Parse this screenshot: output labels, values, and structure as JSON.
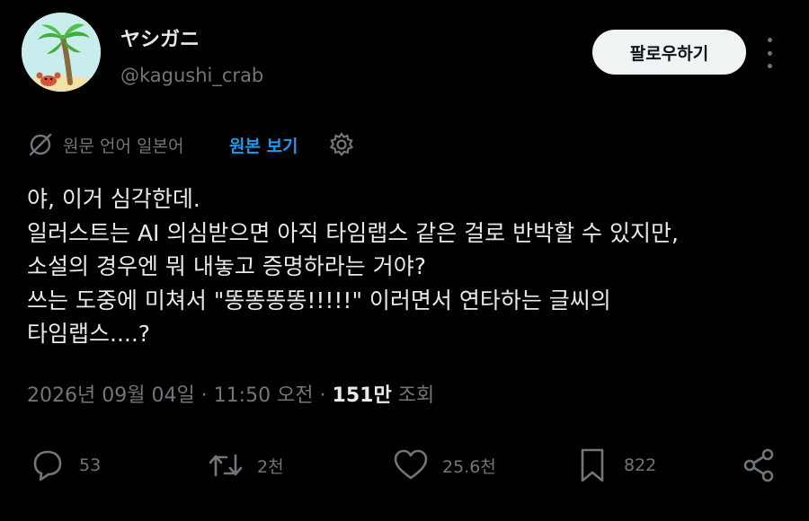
{
  "header": {
    "display_name": "ヤシガニ",
    "handle": "@kagushi_crab",
    "follow_label": "팔로우하기"
  },
  "translation": {
    "source_text": "원문 언어 일본어",
    "show_original_label": "원본 보기"
  },
  "tweet": {
    "lines": [
      "야, 이거 심각한데.",
      "일러스트는 AI 의심받으면 아직 타임랩스 같은 걸로 반박할 수 있지만,",
      "소설의 경우엔 뭐 내놓고 증명하라는 거야?",
      "쓰는 도중에 미쳐서 \"똥똥똥똥!!!!!\" 이러면서 연타하는 글씨의",
      "타임랩스....?"
    ]
  },
  "meta": {
    "datetime": "2026년 09월 04일 · 11:50 오전",
    "separator": " · ",
    "views_count": "151만",
    "views_label": "조회"
  },
  "actions": {
    "replies": "53",
    "retweets": "2천",
    "likes": "25.6천",
    "bookmarks": "822"
  },
  "icons": [
    "avatar-palm-crab",
    "more-icon",
    "translate-icon",
    "gear-icon",
    "reply-icon",
    "retweet-icon",
    "like-icon",
    "bookmark-icon",
    "share-icon"
  ],
  "colors": {
    "background": "#000000",
    "text": "#e7e9ea",
    "muted": "#71767b",
    "link": "#1d9bf0",
    "button": "#eff3f4"
  }
}
